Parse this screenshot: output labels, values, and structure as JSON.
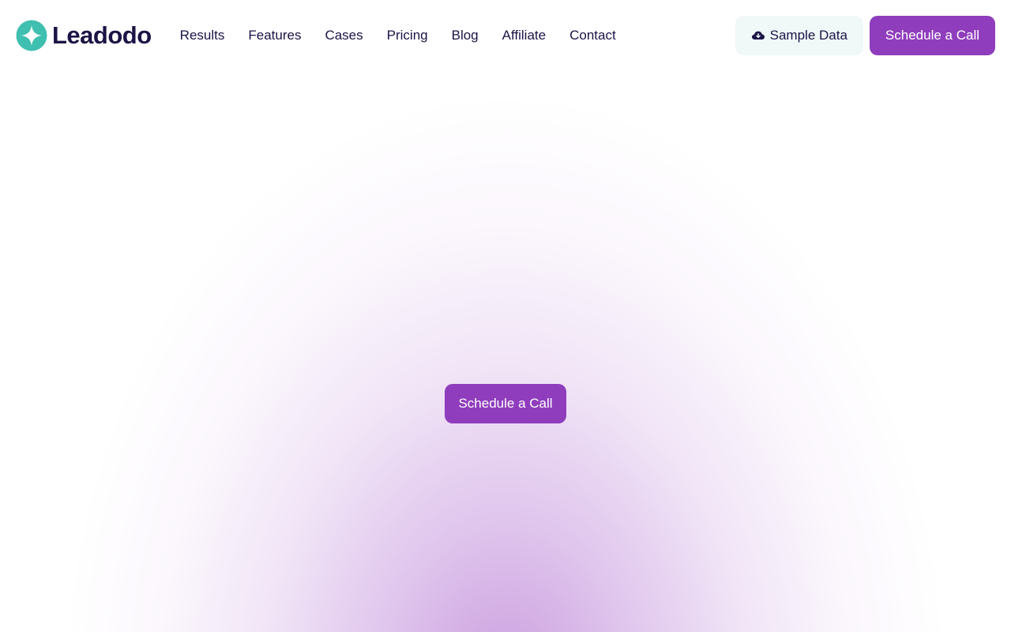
{
  "brand": {
    "name": "Leadodo",
    "logo_icon": "leadodo-logo-mark",
    "colors": {
      "primary": "#8f3dbd",
      "logo_teal": "#3fbfb0",
      "text": "#1b1446",
      "sample_bg": "#f1f9f8"
    }
  },
  "nav": {
    "items": [
      {
        "label": "Results"
      },
      {
        "label": "Features"
      },
      {
        "label": "Cases"
      },
      {
        "label": "Pricing"
      },
      {
        "label": "Blog"
      },
      {
        "label": "Affiliate"
      },
      {
        "label": "Contact"
      }
    ]
  },
  "header_actions": {
    "sample_data_label": "Sample Data",
    "sample_data_icon": "cloud-download-icon",
    "schedule_label": "Schedule a Call"
  },
  "hero": {
    "cta_label": "Schedule a Call"
  }
}
